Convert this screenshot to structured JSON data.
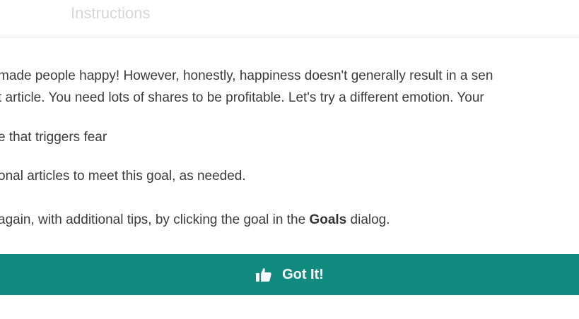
{
  "dialog": {
    "title": "Instructions",
    "paragraph_line1": "made people happy! However, honestly, happiness doesn't generally result in a sen",
    "paragraph_line2": "t article. You need lots of shares to be profitable. Let's try a different emotion. Your",
    "goal_text": "e that triggers fear",
    "goal_note": "onal articles to meet this goal, as needed.",
    "tip_prefix": "again, with additional tips, by clicking the goal in the ",
    "tip_bold": "Goals",
    "tip_suffix": " dialog.",
    "button_label": "Got It!",
    "button_icon": "thumbs-up-icon"
  },
  "colors": {
    "button_background": "#118a80",
    "button_text": "#ffffff",
    "body_text": "#3a3a3a",
    "divider": "#e2e2e2"
  }
}
